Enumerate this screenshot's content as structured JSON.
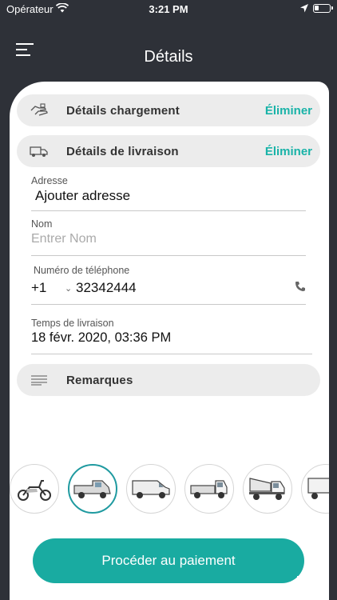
{
  "status_bar": {
    "carrier": "Opérateur",
    "time": "3:21 PM"
  },
  "header": {
    "title": "Détails"
  },
  "sections": {
    "loading": {
      "label": "Détails chargement",
      "action": "Éliminer",
      "icon": "loading-hand-icon"
    },
    "delivery": {
      "label": "Détails de livraison",
      "action": "Éliminer",
      "icon": "truck-icon"
    }
  },
  "form": {
    "address": {
      "label": "Adresse",
      "value": "Ajouter adresse"
    },
    "name": {
      "label": "Nom",
      "placeholder": "Entrer Nom"
    },
    "phone": {
      "label": "Numéro de téléphone",
      "country_code": "+1",
      "number": "32342444"
    },
    "delivery_time": {
      "label": "Temps de livraison",
      "value": "18 févr. 2020, 03:36 PM"
    }
  },
  "remarks": {
    "label": "Remarques",
    "icon": "lines-icon"
  },
  "vehicles": [
    {
      "name": "scooter",
      "selected": false
    },
    {
      "name": "pickup",
      "selected": true
    },
    {
      "name": "van",
      "selected": false
    },
    {
      "name": "small-truck",
      "selected": false
    },
    {
      "name": "tipper-truck",
      "selected": false
    },
    {
      "name": "box-truck",
      "selected": false
    }
  ],
  "footer": {
    "pay_button": "Procéder au paiement"
  },
  "colors": {
    "accent": "#19aba1",
    "background": "#2e3138",
    "pill": "#ececec"
  }
}
